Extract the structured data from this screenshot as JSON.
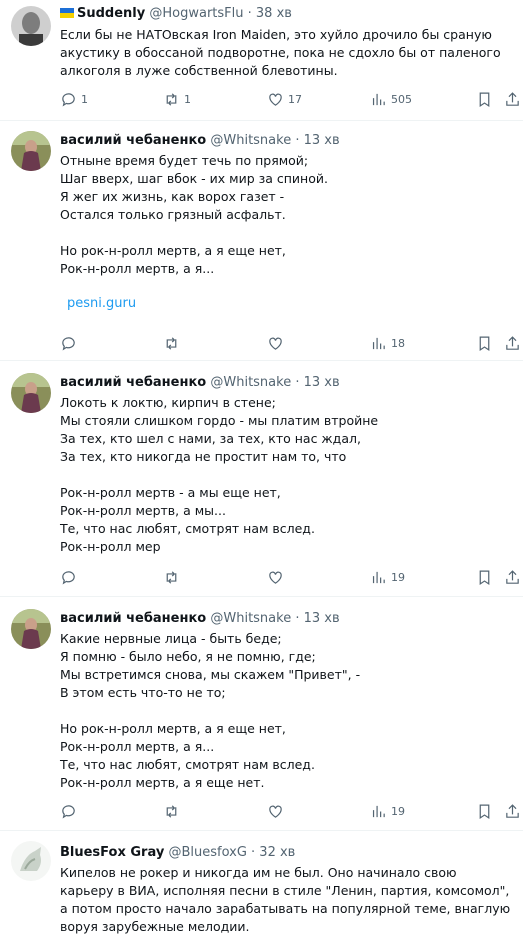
{
  "tweets": [
    {
      "name": "Suddenly",
      "handle": "@HogwartsFlu",
      "time": "· 38 хв",
      "lines": [
        "Если бы не НАТОвская Iron Maiden, это хуйло дрочило бы сраную акустику в обоссаной подворотне, пока не сдохло бы от паленого алкоголя в луже собственной блевотины."
      ],
      "replies": "1",
      "retweets": "1",
      "likes": "17",
      "views": "505"
    },
    {
      "name": "василий чебаненко",
      "handle": "@Whitsnake",
      "time": "· 13 хв",
      "lines": [
        "Отныне время будет течь по прямой;",
        "Шаг вверх, шаг вбок - их мир за спиной.",
        "Я жег их жизнь, как ворох газет -",
        "Остался только грязный асфальт.",
        "",
        "Но рок-н-ролл мертв, а я еще нет,",
        "Рок-н-ролл мертв, а я..."
      ],
      "link": "pesni.guru",
      "replies": "",
      "retweets": "",
      "likes": "",
      "views": "18"
    },
    {
      "name": "василий чебаненко",
      "handle": "@Whitsnake",
      "time": "· 13 хв",
      "lines": [
        "Локоть к локтю, кирпич в стене;",
        "Мы стояли слишком гордо - мы платим втройне",
        "За тех, кто шел с нами, за тех, кто нас ждал,",
        "За тех, кто никогда не простит нам то, что",
        "",
        "Рок-н-ролл мертв - а мы еще нет,",
        "Рок-н-ролл мертв, а мы...",
        "Те, что нас любят, смотрят нам вслед.",
        "Рок-н-ролл мер"
      ],
      "replies": "",
      "retweets": "",
      "likes": "",
      "views": "19"
    },
    {
      "name": "василий чебаненко",
      "handle": "@Whitsnake",
      "time": "· 13 хв",
      "lines": [
        "Какие нервные лица - быть беде;",
        "Я помню - было небо, я не помню, где;",
        "Мы встретимся снова, мы скажем \"Привет\", -",
        "В этом есть что-то не то;",
        "",
        "Но рок-н-ролл мертв, а я еще нет,",
        "Рок-н-ролл мертв, а я...",
        "Те, что нас любят, смотрят нам вслед.",
        "Рок-н-ролл мертв, а я еще нет."
      ],
      "replies": "",
      "retweets": "",
      "likes": "",
      "views": "19"
    },
    {
      "name": "BluesFox Gray",
      "handle": "@BluesfoxG",
      "time": "· 32 хв",
      "lines": [
        "Кипелов не рокер и никогда им не был. Оно начинало свою карьеру в ВИА, исполняя песни в стиле \"Ленин, партия, комсомол\", а потом просто начало зарабатывать на популярной теме, внаглую воруя зарубежные мелодии."
      ]
    }
  ],
  "colors": {
    "text": "#0f1419",
    "muted": "#536471",
    "link": "#1d9bf0",
    "divider": "#eff3f4"
  }
}
